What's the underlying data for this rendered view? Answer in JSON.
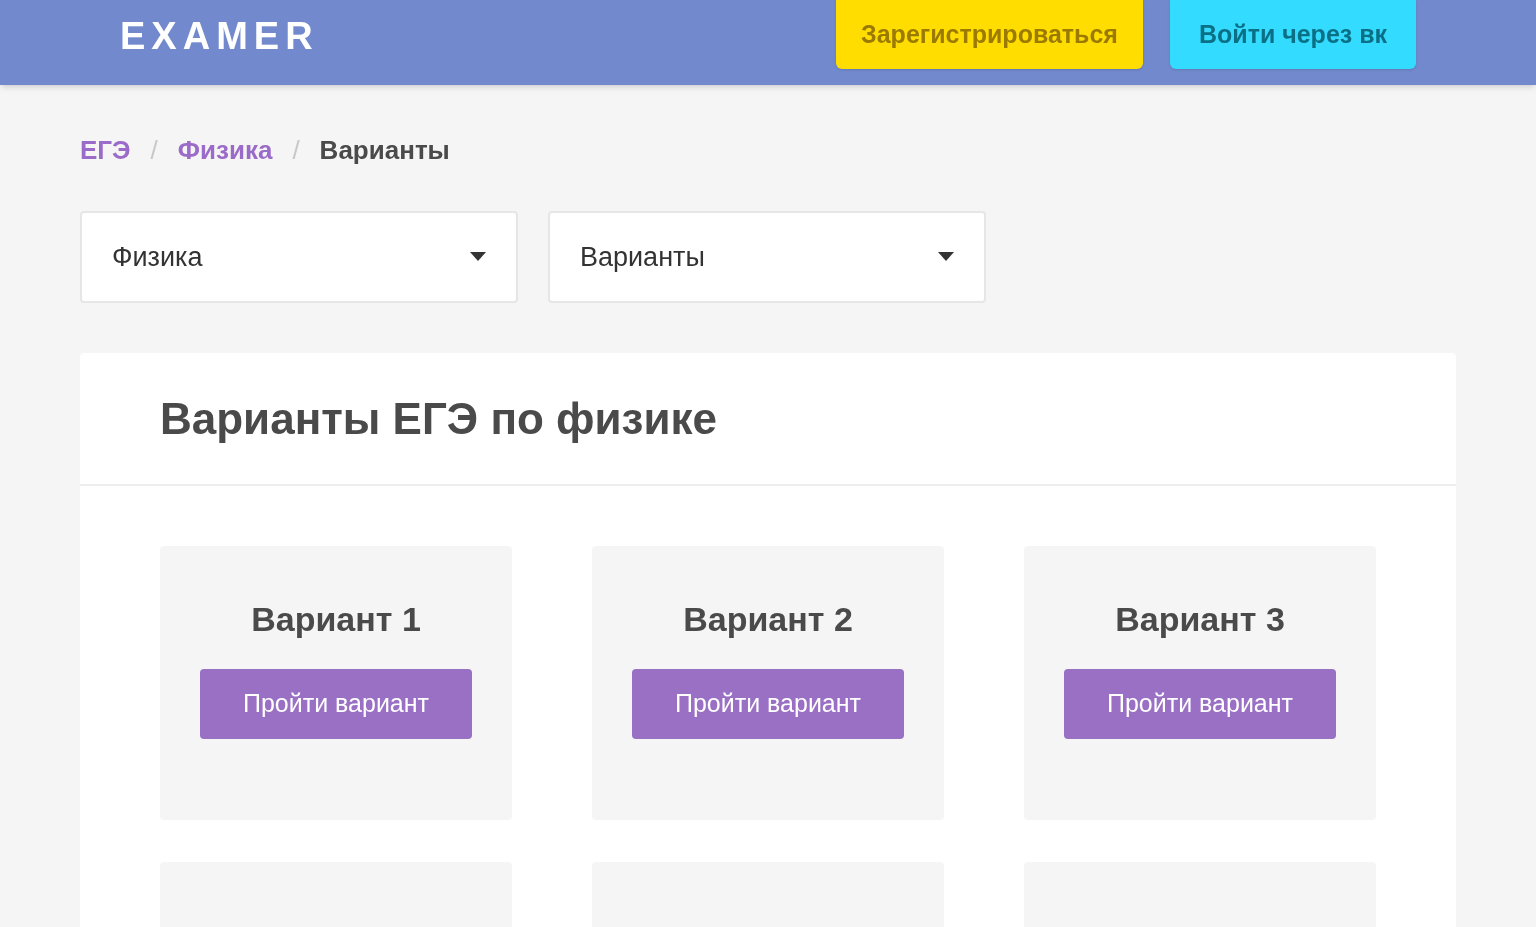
{
  "header": {
    "logo": "EXAMER",
    "buttons": [
      {
        "kind": "register",
        "label": "Зарегистрироваться"
      },
      {
        "kind": "vk",
        "label": "Войти через вк"
      }
    ]
  },
  "breadcrumbs": [
    {
      "label": "ЕГЭ",
      "current": false
    },
    {
      "label": "Физика",
      "current": false
    },
    {
      "label": "Варианты",
      "current": true
    }
  ],
  "separator": "/",
  "selects": [
    {
      "value": "Физика"
    },
    {
      "value": "Варианты"
    }
  ],
  "panel": {
    "title": "Варианты ЕГЭ по физике",
    "cards": [
      {
        "kind": "variant",
        "title": "Вариант 1",
        "button": "Пройти вариант"
      },
      {
        "kind": "variant",
        "title": "Вариант 2",
        "button": "Пройти вариант"
      },
      {
        "kind": "variant",
        "title": "Вариант 3",
        "button": "Пройти вариант"
      },
      {
        "kind": "cut-off"
      },
      {
        "kind": "cut-off"
      },
      {
        "kind": "cut-off"
      }
    ]
  }
}
